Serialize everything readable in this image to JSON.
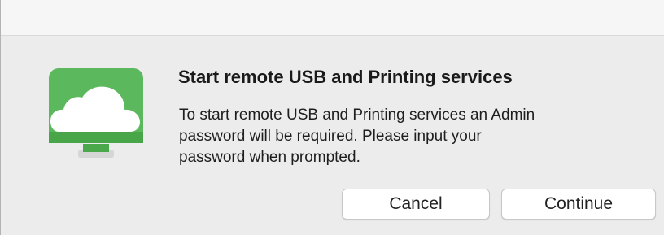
{
  "dialog": {
    "title": "Start remote USB and Printing services",
    "message_lines": [
      "To start remote USB and Printing services an Admin",
      "password will be required.  Please input your",
      "password when prompted."
    ],
    "icon": "cloud-monitor-icon",
    "buttons": {
      "cancel_label": "Cancel",
      "continue_label": "Continue"
    }
  },
  "colors": {
    "icon_green": "#5cb85c",
    "icon_green_dark": "#3f9b3f",
    "background": "#ececec"
  }
}
